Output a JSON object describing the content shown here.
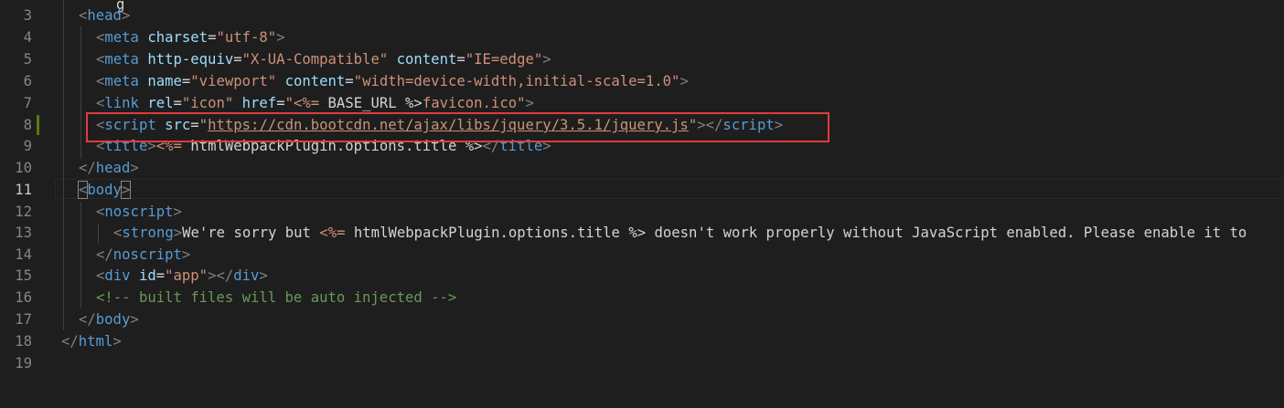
{
  "editor": {
    "line_numbers": [
      "3",
      "4",
      "5",
      "6",
      "7",
      "8",
      "9",
      "10",
      "11",
      "12",
      "13",
      "14",
      "15",
      "16",
      "17",
      "18",
      "19"
    ],
    "active_line": "11",
    "lines": {
      "l3": {
        "open": "<",
        "tag": "head",
        "close": ">"
      },
      "l4": {
        "open": "<",
        "tag": "meta",
        "a1": "charset",
        "eq": "=",
        "v1": "\"utf-8\"",
        "close": ">"
      },
      "l5": {
        "open": "<",
        "tag": "meta",
        "a1": "http-equiv",
        "eq1": "=",
        "v1": "\"X-UA-Compatible\"",
        "a2": "content",
        "eq2": "=",
        "v2": "\"IE=edge\"",
        "close": ">"
      },
      "l6": {
        "open": "<",
        "tag": "meta",
        "a1": "name",
        "eq1": "=",
        "v1": "\"viewport\"",
        "a2": "content",
        "eq2": "=",
        "v2": "\"width=device-width,initial-scale=1.0\"",
        "close": ">"
      },
      "l7": {
        "open": "<",
        "tag": "link",
        "a1": "rel",
        "eq1": "=",
        "v1": "\"icon\"",
        "a2": "href",
        "eq2": "=",
        "q": "\"",
        "tmpl_open": "<%=",
        "tmpl_body": " BASE_URL ",
        "tmpl_close": "%>",
        "rest": "favicon.ico\"",
        "close": ">"
      },
      "l8": {
        "open": "<",
        "tag": "script",
        "a1": "src",
        "eq": "=",
        "q1": "\"",
        "url": "https://cdn.bootcdn.net/ajax/libs/jquery/3.5.1/jquery.js",
        "q2": "\"",
        "close": ">",
        "end_open": "</",
        "end_tag": "script",
        "end_close": ">"
      },
      "l9": {
        "open": "<",
        "tag": "title",
        "close": ">",
        "tmpl_open": "<%=",
        "tmpl_body": " htmlWebpackPlugin.options.title ",
        "tmpl_close": "%>",
        "end_open": "</",
        "end_tag": "title",
        "end_close": ">"
      },
      "l10": {
        "open": "</",
        "tag": "head",
        "close": ">"
      },
      "l11": {
        "open": "<",
        "tag": "body",
        "close": ">"
      },
      "l12": {
        "open": "<",
        "tag": "noscript",
        "close": ">"
      },
      "l13": {
        "open": "<",
        "tag": "strong",
        "close": ">",
        "text1": "We're sorry but ",
        "tmpl_open": "<%=",
        "tmpl_body": " htmlWebpackPlugin.options.title ",
        "tmpl_close": "%>",
        "text2": " doesn't work properly without JavaScript enabled. Please enable it to"
      },
      "l14": {
        "open": "</",
        "tag": "noscript",
        "close": ">"
      },
      "l15": {
        "open": "<",
        "tag": "div",
        "a1": "id",
        "eq": "=",
        "v1": "\"app\"",
        "close": ">",
        "end_open": "</",
        "end_tag": "div",
        "end_close": ">"
      },
      "l16": {
        "comment": "<!-- built files will be auto injected -->"
      },
      "l17": {
        "open": "</",
        "tag": "body",
        "close": ">"
      },
      "l18": {
        "open": "</",
        "tag": "html",
        "close": ">"
      }
    },
    "partial_top_text": "g"
  },
  "colors": {
    "background": "#1e1e1e",
    "tag": "#569cd6",
    "attribute": "#9cdcfe",
    "string": "#ce9178",
    "comment": "#6a9955",
    "highlight_box": "#e03c3c",
    "modified_bar": "#587c0c"
  }
}
